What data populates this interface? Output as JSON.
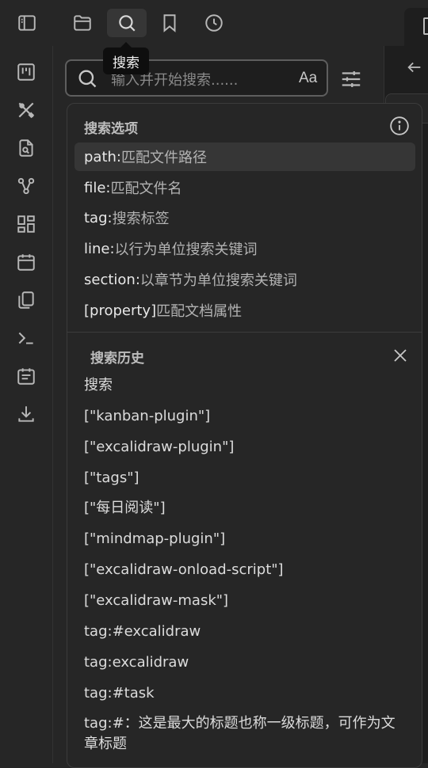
{
  "toolbar": {
    "buttons": [
      {
        "name": "sidebar-toggle-icon"
      },
      {
        "name": "folder-icon"
      },
      {
        "name": "search-icon",
        "active": true
      },
      {
        "name": "bookmark-icon"
      },
      {
        "name": "clock-icon"
      }
    ],
    "tooltip": "搜索"
  },
  "ribbon": {
    "icons": [
      "kanban-icon",
      "excalidraw-icon",
      "file-search-icon",
      "graph-icon",
      "dashboard-icon",
      "calendar-icon",
      "copy-icon",
      "terminal-icon",
      "daily-note-icon",
      "download-icon"
    ]
  },
  "search": {
    "placeholder": "输入并开始搜索......",
    "match_case_label": "Aa"
  },
  "options": {
    "title": "搜索选项",
    "items": [
      {
        "key": "path:",
        "desc": " 匹配文件路径"
      },
      {
        "key": "file:",
        "desc": " 匹配文件名"
      },
      {
        "key": "tag:",
        "desc": " 搜索标签"
      },
      {
        "key": "line:",
        "desc": " 以行为单位搜索关键词"
      },
      {
        "key": "section:",
        "desc": " 以章节为单位搜索关键词"
      },
      {
        "key": "[property]",
        "desc": " 匹配文档属性"
      }
    ]
  },
  "history": {
    "title": "搜索历史",
    "items": [
      "搜索",
      "[\"kanban-plugin\"]",
      "[\"excalidraw-plugin\"]",
      "[\"tags\"]",
      "[\"每日阅读\"]",
      "[\"mindmap-plugin\"]",
      "[\"excalidraw-onload-script\"]",
      "[\"excalidraw-mask\"]",
      "tag:#excalidraw",
      "tag:excalidraw",
      "tag:#task",
      "tag:#：这是最大的标题也称一级标题，可作为文章标题"
    ]
  },
  "colors": {
    "background": "#262626",
    "panel": "#1e1e1e",
    "highlight": "#363636",
    "icon": "#b8b8b8"
  }
}
